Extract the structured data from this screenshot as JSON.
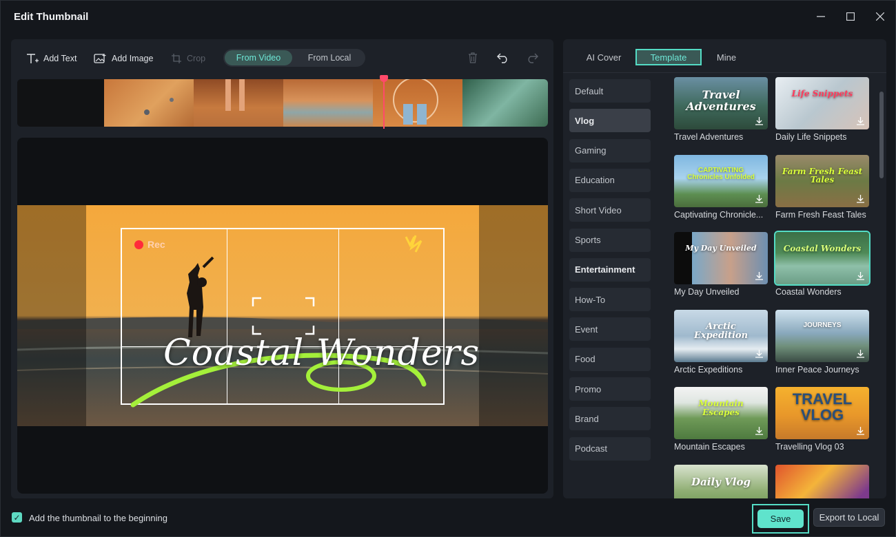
{
  "window": {
    "title": "Edit Thumbnail"
  },
  "toolbar": {
    "add_text": "Add Text",
    "add_image": "Add Image",
    "crop": "Crop",
    "from_video": "From Video",
    "from_local": "From Local"
  },
  "preview": {
    "rec_label": "Rec",
    "title_text": "Coastal Wonders"
  },
  "tabs": {
    "ai_cover": "AI Cover",
    "template": "Template",
    "mine": "Mine"
  },
  "categories": [
    "Default",
    "Vlog",
    "Gaming",
    "Education",
    "Short Video",
    "Sports",
    "Entertainment",
    "How-To",
    "Event",
    "Food",
    "Promo",
    "Brand",
    "Podcast"
  ],
  "selected_category": "Vlog",
  "templates": [
    {
      "name": "Travel Adventures",
      "overlay": "Travel Adventures"
    },
    {
      "name": "Daily Life Snippets",
      "overlay": "Life Snippets"
    },
    {
      "name": "Captivating Chronicle...",
      "overlay": "CAPTIVATING Chronicles Unfolded"
    },
    {
      "name": "Farm Fresh Feast Tales",
      "overlay": "Farm Fresh Feast Tales"
    },
    {
      "name": "My Day Unveiled",
      "overlay": "My Day Unveiled"
    },
    {
      "name": "Coastal Wonders",
      "overlay": "Coastal Wonders"
    },
    {
      "name": "Arctic Expeditions",
      "overlay": "Arctic Expedition"
    },
    {
      "name": "Inner Peace Journeys",
      "overlay": "JOURNEYS"
    },
    {
      "name": "Mountain Escapes",
      "overlay": "Mountain Escapes"
    },
    {
      "name": "Travelling Vlog 03",
      "overlay": "TRAVEL VLOG"
    },
    {
      "name": "",
      "overlay": "Daily Vlog"
    },
    {
      "name": "",
      "overlay": ""
    }
  ],
  "selected_template": "Coastal Wonders",
  "footer": {
    "checkbox_label": "Add the thumbnail to the beginning",
    "checkbox_checked": true,
    "save": "Save",
    "export": "Export to Local"
  },
  "colors": {
    "accent": "#5fe3cc",
    "background": "#14171c",
    "panel": "#1d2128",
    "playhead": "#ff4a6a"
  }
}
